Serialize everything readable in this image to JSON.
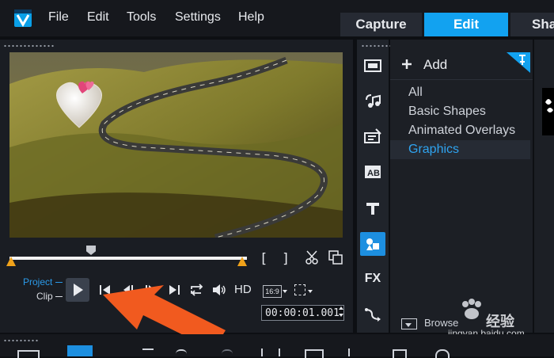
{
  "menu": {
    "file": "File",
    "edit": "Edit",
    "tools": "Tools",
    "settings": "Settings",
    "help": "Help"
  },
  "tabs": {
    "capture": "Capture",
    "edit": "Edit",
    "share": "Sha"
  },
  "player": {
    "mode_project": "Project",
    "mode_clip": "Clip",
    "hd": "HD",
    "aspect": "16:9",
    "timecode": "00:00:01.001",
    "mark_in": "[",
    "mark_out": "]"
  },
  "library": {
    "add_label": "Add",
    "items": [
      "All",
      "Basic Shapes",
      "Animated Overlays",
      "Graphics"
    ],
    "selected": "Graphics",
    "browse_label": "Browse",
    "rail_fx": "FX"
  },
  "watermark": {
    "site": "jingyan.baidu.com",
    "brand": "经验"
  },
  "colors": {
    "accent": "#12a2f0",
    "annotation_arrow": "#f15a1f"
  }
}
